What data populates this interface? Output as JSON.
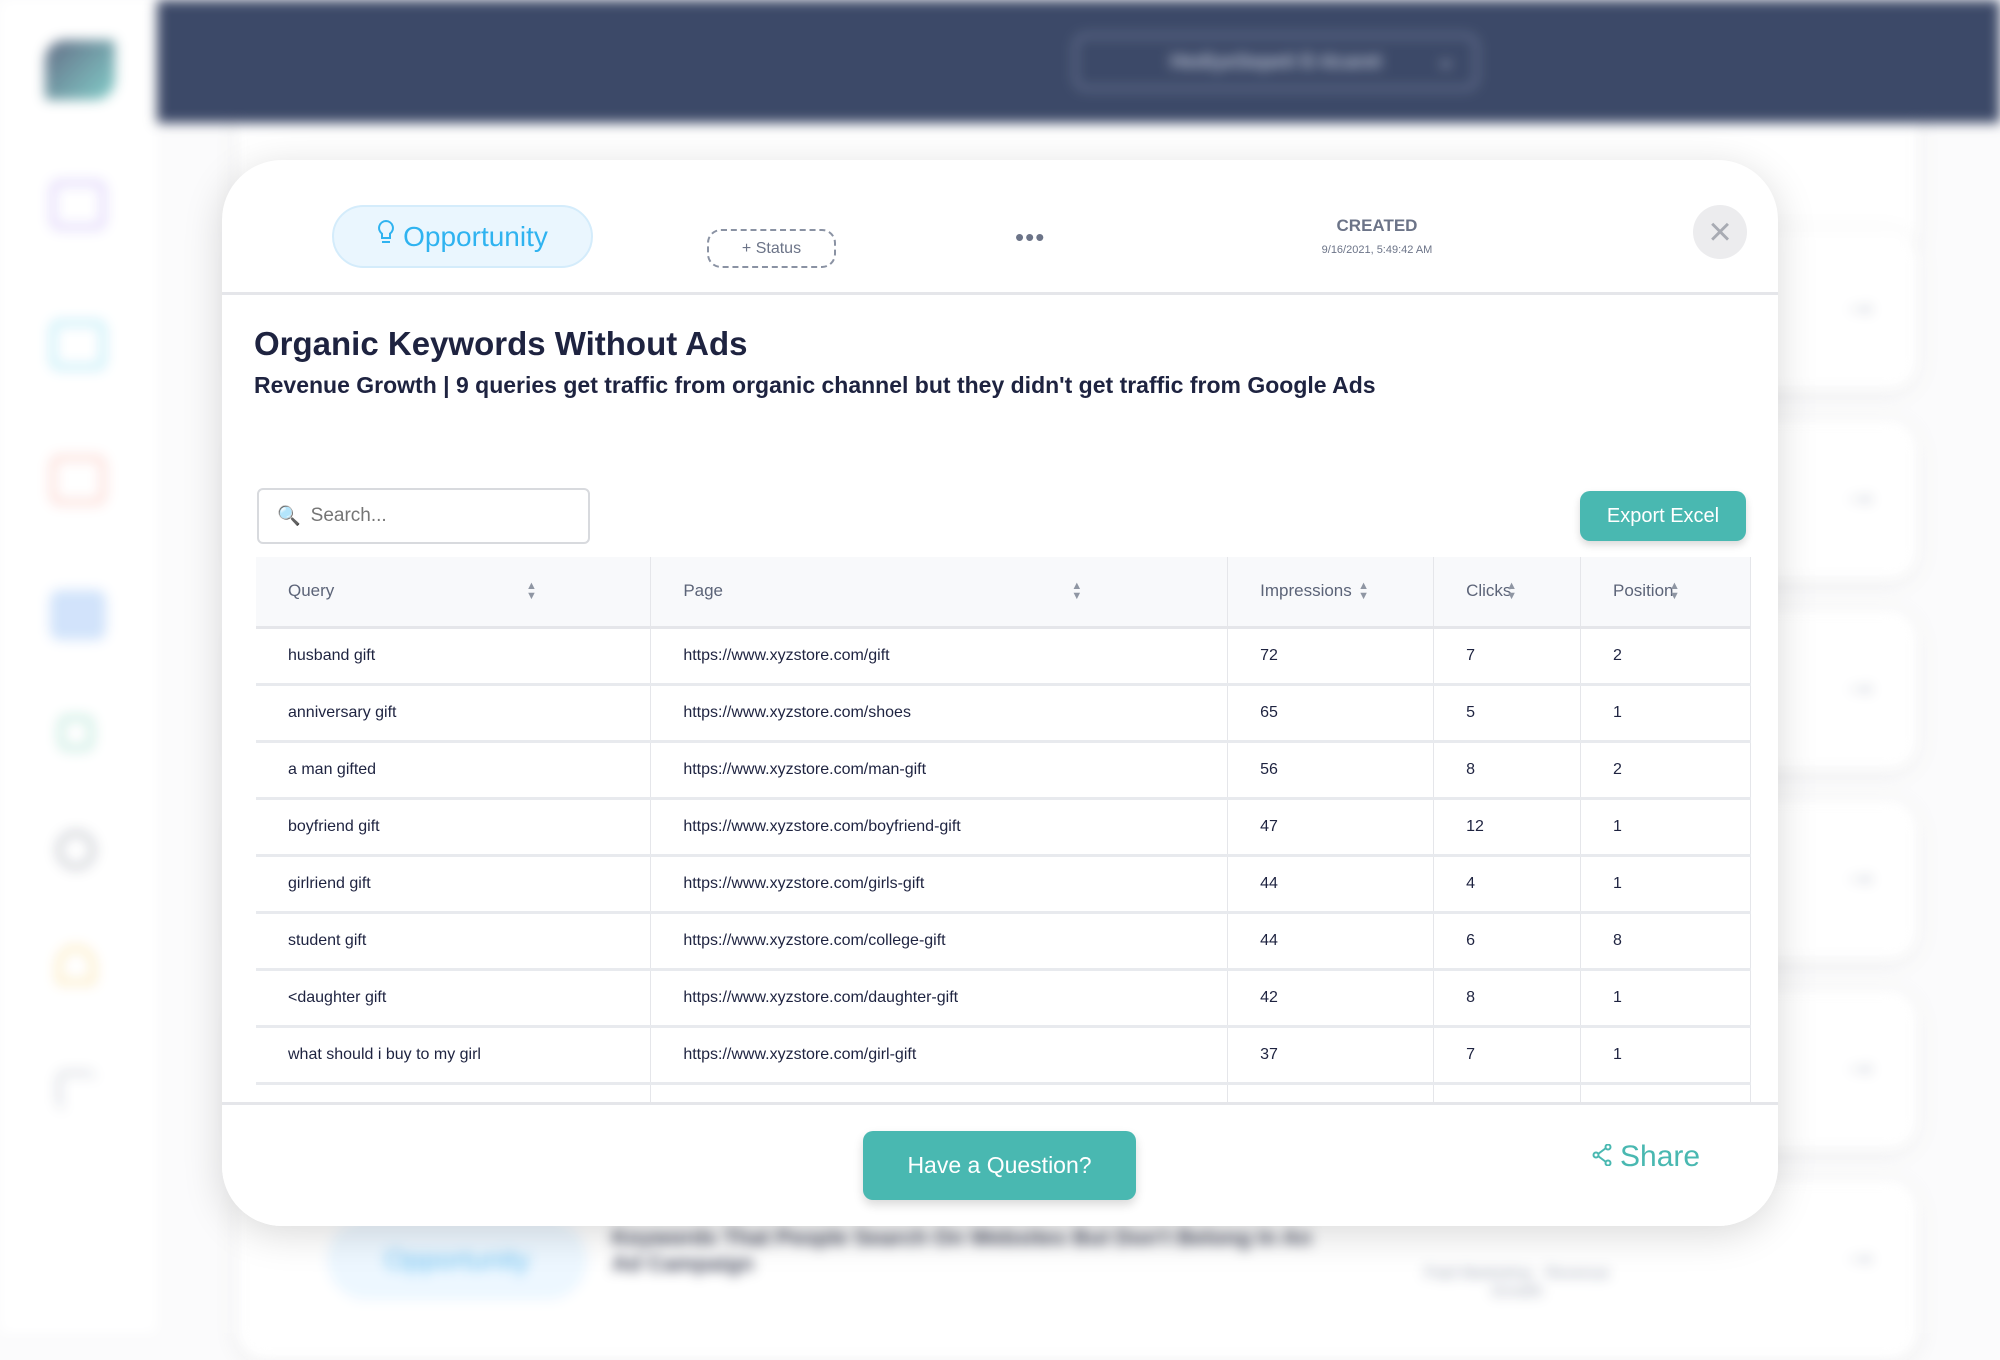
{
  "topbar": {
    "workspace": "HediyeSepeti E-ticaret"
  },
  "background": {
    "card_title": "Keywords That People Search On Websites But Don't Belong In An Ad Campaign",
    "card_badge": "Opportunity",
    "card_meta": "Paid Marketing · Revenue Growth"
  },
  "colors": {
    "accent": "#49b8b1",
    "topbar": "#1b2a4e",
    "opportunity": "#2fb3f0"
  },
  "modal": {
    "badge": "Opportunity",
    "status_button": "+ Status",
    "more": "•••",
    "created_label": "CREATED",
    "created_date": "9/16/2021, 5:49:42 AM",
    "title": "Organic Keywords Without Ads",
    "subtitle": "Revenue Growth | 9 queries get traffic from organic channel but they didn't get traffic from Google Ads",
    "search_placeholder": "Search...",
    "export_label": "Export Excel",
    "columns": [
      "Query",
      "Page",
      "Impressions",
      "Clicks",
      "Position"
    ],
    "rows": [
      [
        "husband gift",
        "https://www.xyzstore.com/gift",
        "72",
        "7",
        "2"
      ],
      [
        "anniversary gift",
        "https://www.xyzstore.com/shoes",
        "65",
        "5",
        "1"
      ],
      [
        "a man gifted",
        "https://www.xyzstore.com/man-gift",
        "56",
        "8",
        "2"
      ],
      [
        "boyfriend gift",
        "https://www.xyzstore.com/boyfriend-gift",
        "47",
        "12",
        "1"
      ],
      [
        "girlriend gift",
        "https://www.xyzstore.com/girls-gift",
        "44",
        "4",
        "1"
      ],
      [
        "student gift",
        "https://www.xyzstore.com/college-gift",
        "44",
        "6",
        "8"
      ],
      [
        "<daughter gift",
        "https://www.xyzstore.com/daughter-gift",
        "42",
        "8",
        "1"
      ],
      [
        "what should i buy to my girl",
        "https://www.xyzstore.com/girl-gift",
        "37",
        "7",
        "1"
      ]
    ],
    "ask_label": "Have a Question?",
    "share_label": "Share"
  }
}
